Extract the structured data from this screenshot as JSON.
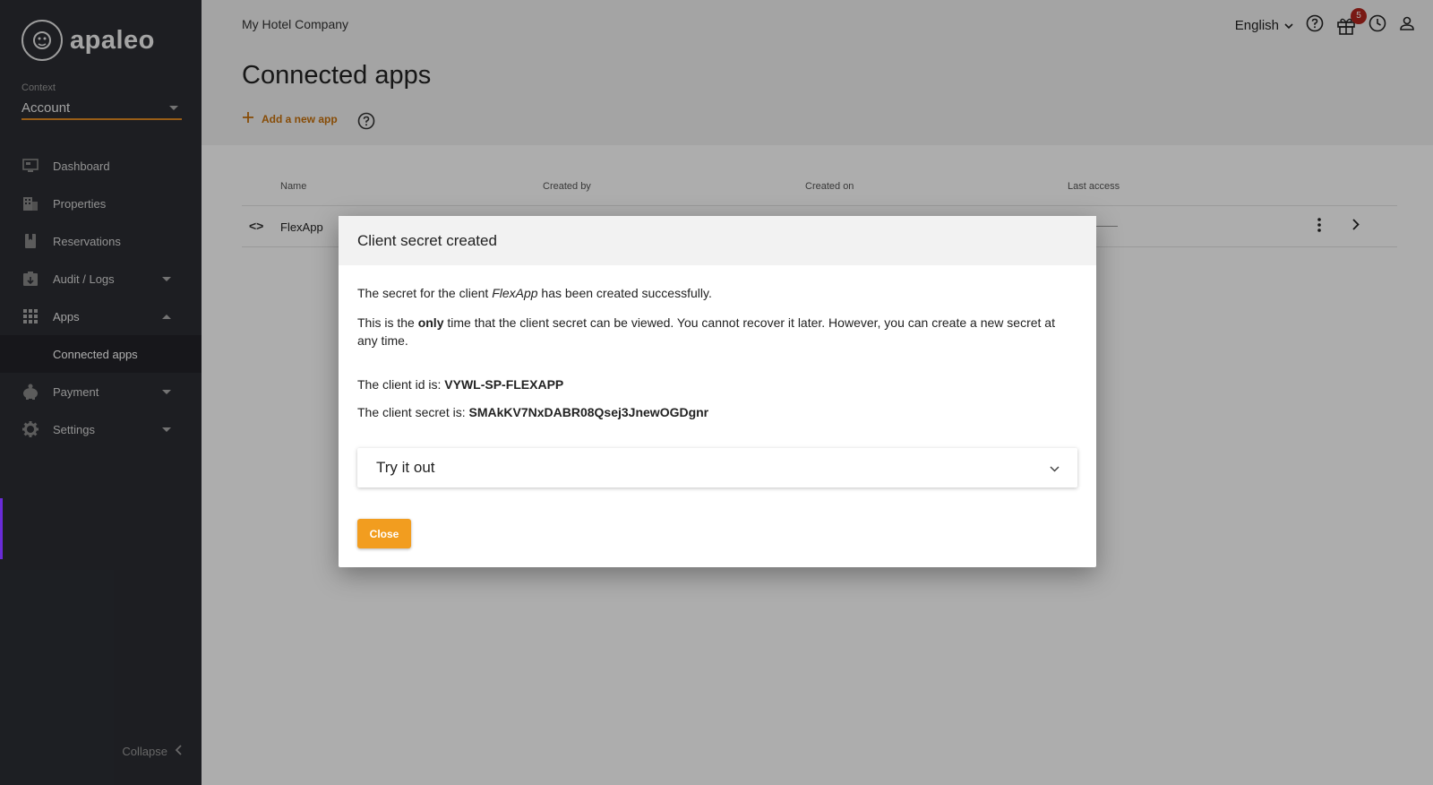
{
  "brand": {
    "name": "apaleo"
  },
  "context": {
    "label": "Context",
    "value": "Account"
  },
  "sidebar": {
    "items": [
      {
        "label": "Dashboard",
        "icon": "dashboard-icon"
      },
      {
        "label": "Properties",
        "icon": "building-icon"
      },
      {
        "label": "Reservations",
        "icon": "book-icon"
      },
      {
        "label": "Audit / Logs",
        "icon": "audit-icon"
      },
      {
        "label": "Apps",
        "icon": "grid-icon"
      },
      {
        "label": "Payment",
        "icon": "piggy-bank-icon"
      },
      {
        "label": "Settings",
        "icon": "gear-icon"
      }
    ],
    "sub_item": "Connected apps",
    "collapse_label": "Collapse"
  },
  "header": {
    "company": "My Hotel Company",
    "title": "Connected apps",
    "add_app_label": "Add a new app",
    "language": "English",
    "notification_count": "5"
  },
  "table": {
    "columns": [
      "Name",
      "Created by",
      "Created on",
      "Last access"
    ],
    "rows": [
      {
        "name": "FlexApp"
      }
    ]
  },
  "dialog": {
    "title": "Client secret created",
    "line1_pre": "The secret for the client ",
    "line1_app": "FlexApp",
    "line1_post": " has been created successfully.",
    "line2_pre": "This is the ",
    "line2_emph": "only",
    "line2_post": " time that the client secret can be viewed. You cannot recover it later. However, you can create a new secret at any time.",
    "client_id_label": "The client id is: ",
    "client_id": "VYWL-SP-FLEXAPP",
    "client_secret_label": "The client secret is: ",
    "client_secret": "SMAkKV7NxDABR08Qsej3JnewOGDgnr",
    "try_label": "Try it out",
    "close_label": "Close"
  },
  "colors": {
    "accent": "#f29d1f",
    "accent_text": "#c8700a",
    "sidebar_bg": "#2b2d33",
    "badge": "#b3261e"
  }
}
